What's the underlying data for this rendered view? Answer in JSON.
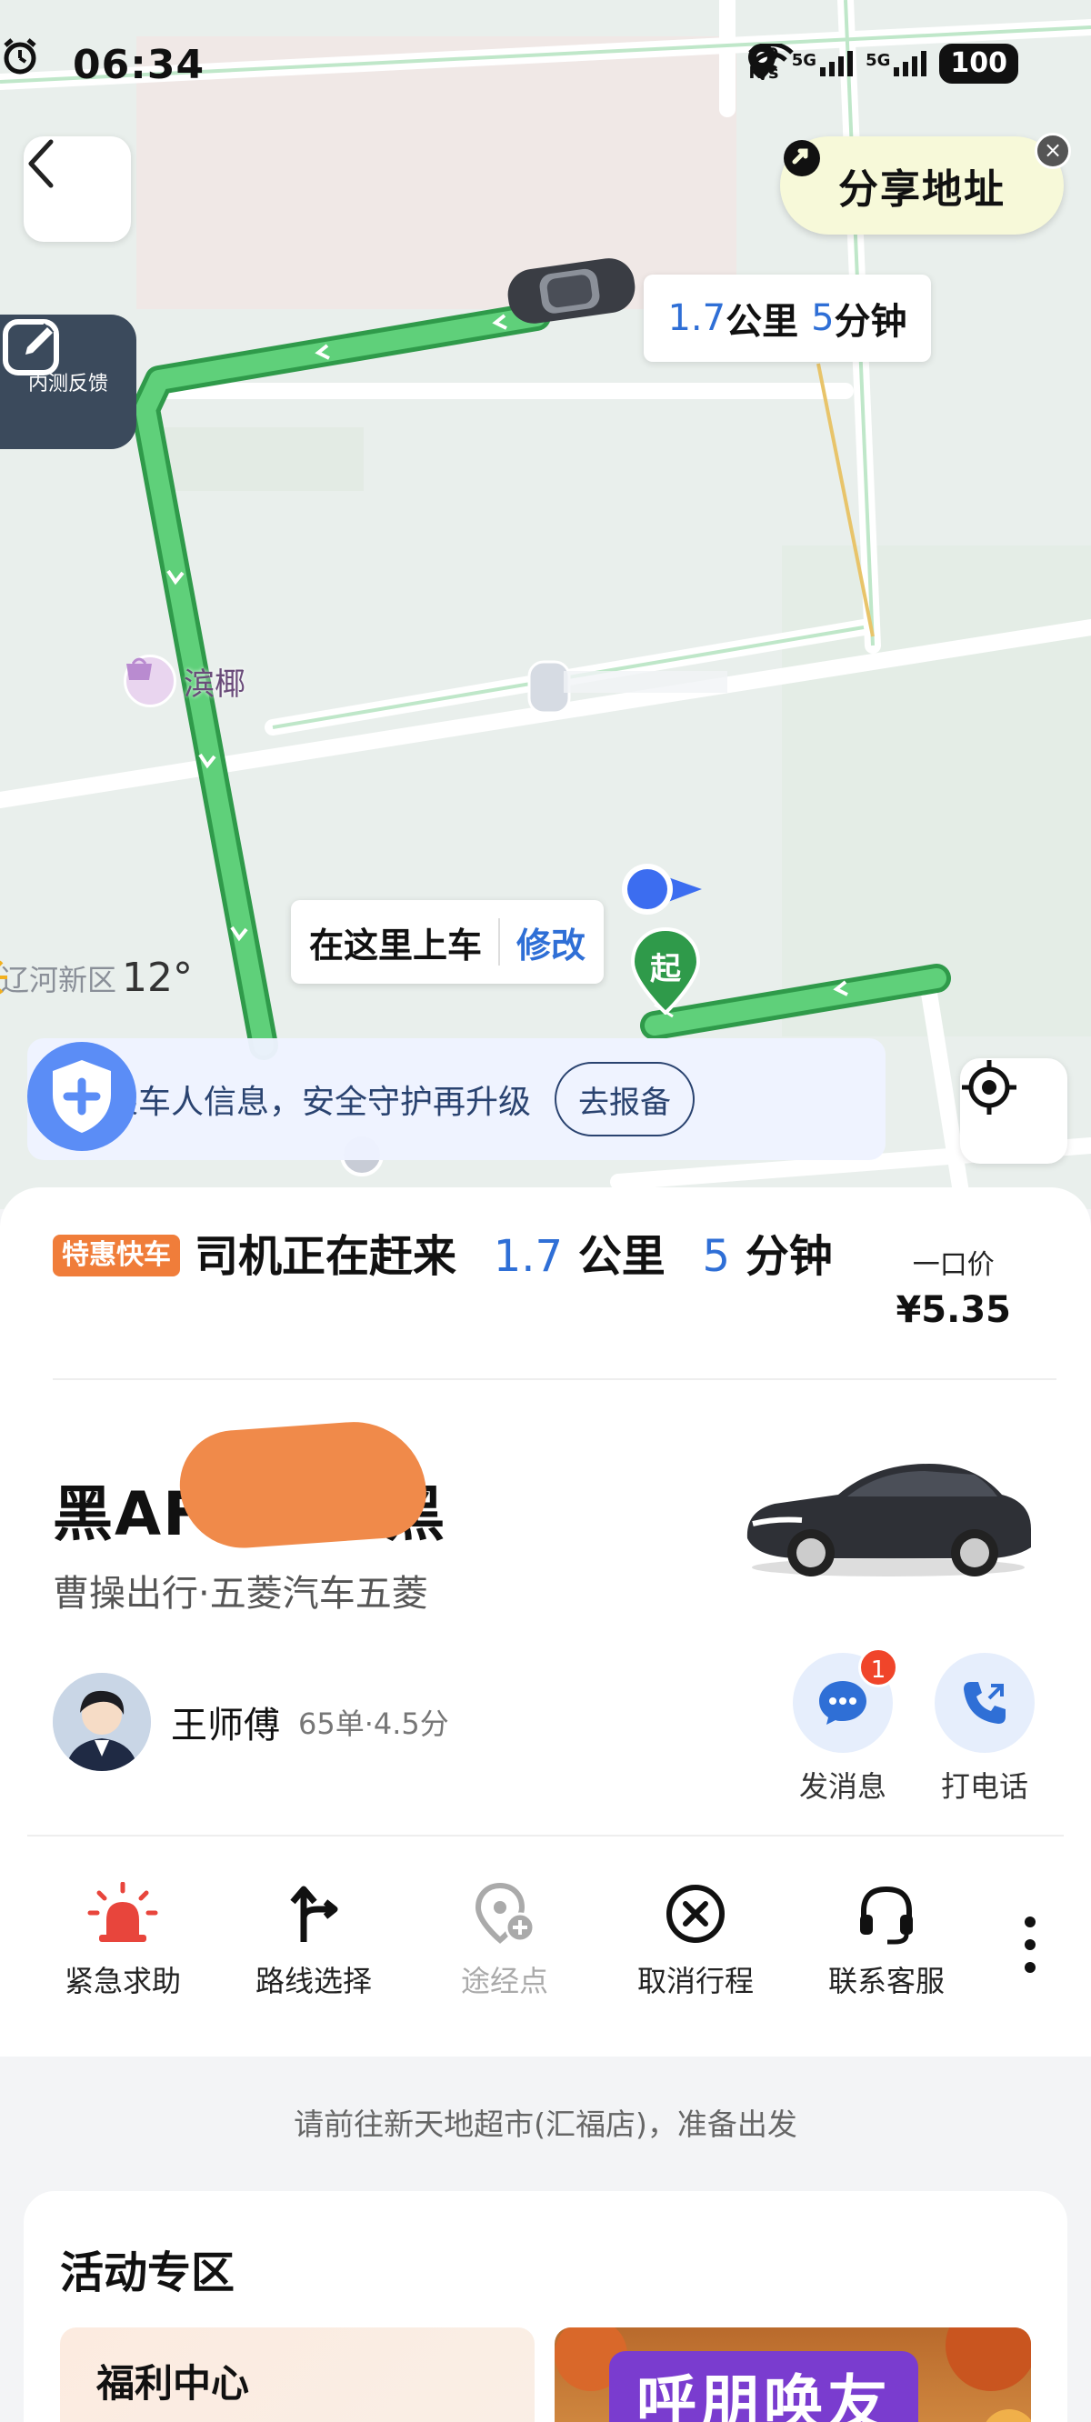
{
  "status_bar": {
    "time": "06:34",
    "net_speed_value": "6.9",
    "net_speed_unit": "K/s",
    "signal_1": "5G",
    "signal_2": "5G",
    "battery": "100"
  },
  "map": {
    "share_label": "分享地址",
    "feedback_label": "内测反馈",
    "eta": {
      "distance": "1.7",
      "distance_unit": "公里",
      "minutes": "5",
      "minutes_unit": "分钟"
    },
    "poi_label": "滨椰",
    "weather": {
      "district": "辽河新区",
      "temperature": "12°"
    },
    "pickup": {
      "label": "在这里上车",
      "edit": "修改"
    },
    "start_pin_label": "起",
    "safety_banner": {
      "text": "报备乘车人信息，安全守护再升级",
      "button": "去报备"
    }
  },
  "trip": {
    "tag": "特惠快车",
    "status_text": "司机正在赶来",
    "distance": "1.7",
    "distance_unit": "公里",
    "minutes": "5",
    "minutes_unit": "分钟",
    "price_label": "一口价",
    "price": "¥5.35"
  },
  "vehicle": {
    "plate_prefix": "黑AF",
    "plate_suffix": "·黑",
    "description": "曹操出行·五菱汽车五菱"
  },
  "driver": {
    "name": "王师傅",
    "stats": "65单·4.5分",
    "message_label": "发消息",
    "message_badge": "1",
    "call_label": "打电话"
  },
  "actions": [
    {
      "label": "紧急求助",
      "icon": "alarm-icon"
    },
    {
      "label": "路线选择",
      "icon": "route-icon"
    },
    {
      "label": "途经点",
      "icon": "waypoint-icon"
    },
    {
      "label": "取消行程",
      "icon": "cancel-icon"
    },
    {
      "label": "联系客服",
      "icon": "headset-icon"
    }
  ],
  "hint": "请前往新天地超市(汇福店)，准备出发",
  "activity": {
    "title": "活动专区",
    "welfare_title": "福利中心",
    "promo_title": "呼朋唤友"
  },
  "colors": {
    "route_green": "#4cbf6a",
    "accent_blue": "#2f6fd6",
    "tag_orange": "#f07d3a",
    "alarm_red": "#e8453c"
  }
}
